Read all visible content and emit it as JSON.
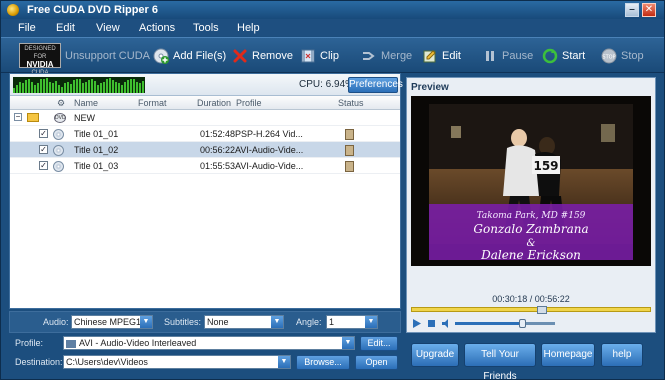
{
  "window": {
    "title": "Free CUDA DVD Ripper 6"
  },
  "menu": [
    "File",
    "Edit",
    "View",
    "Actions",
    "Tools",
    "Help"
  ],
  "toolbar": {
    "cuda_label": "Unsupport CUDA",
    "add_files": "Add File(s)",
    "remove": "Remove",
    "clip": "Clip",
    "merge": "Merge",
    "edit": "Edit",
    "pause": "Pause",
    "start": "Start",
    "stop": "Stop"
  },
  "nvidia_badge": {
    "top": "DESIGNED FOR",
    "brand": "NVIDIA",
    "bottom": "CUDA"
  },
  "status": {
    "cpu": "CPU: 6.94%",
    "preferences": "Preferences"
  },
  "meter_levels": [
    0.3,
    0.5,
    0.7,
    0.6,
    0.8,
    0.9,
    0.7,
    0.5,
    0.6,
    0.85,
    0.9,
    0.95,
    0.7,
    0.6,
    0.75,
    0.5,
    0.4,
    0.6,
    0.7,
    0.55,
    0.8,
    0.9,
    0.85,
    0.6,
    0.7,
    0.8,
    0.9,
    0.75,
    0.5,
    0.6,
    0.7,
    0.85,
    0.95,
    0.8,
    0.7,
    0.6,
    0.5,
    0.7,
    0.8,
    0.9,
    0.85,
    0.7,
    0.6,
    0.75
  ],
  "columns": {
    "name": "Name",
    "format": "Format",
    "duration": "Duration",
    "profile": "Profile",
    "status": "Status"
  },
  "root": {
    "label": "NEW",
    "dvd": "DVD"
  },
  "titles": [
    {
      "name": "Title 01_01",
      "duration": "01:52:48",
      "profile": "PSP-H.264 Vid...",
      "checked": true,
      "selected": false
    },
    {
      "name": "Title 01_02",
      "duration": "00:56:22",
      "profile": "AVI-Audio-Vide...",
      "checked": true,
      "selected": true
    },
    {
      "name": "Title 01_03",
      "duration": "01:55:53",
      "profile": "AVI-Audio-Vide...",
      "checked": true,
      "selected": false
    }
  ],
  "audio": {
    "audio_label": "Audio:",
    "audio_value": "Chinese MPEG1 :",
    "subtitles_label": "Subtitles:",
    "subtitles_value": "None",
    "angle_label": "Angle:",
    "angle_value": "1"
  },
  "profile": {
    "label": "Profile:",
    "value": "AVI - Audio-Video Interleaved",
    "edit": "Edit..."
  },
  "destination": {
    "label": "Destination:",
    "value": "C:\\Users\\dev\\Videos",
    "browse": "Browse...",
    "open": "Open"
  },
  "preview": {
    "title": "Preview",
    "caption_line1": "Takoma Park, MD #159",
    "caption_line2": "Gonzalo Zambrana",
    "caption_line3": "&",
    "caption_line4": "Dalene Erickson",
    "bib": "159",
    "timecode": "00:30:18 / 00:56:22",
    "progress": 0.54,
    "volume": 0.68
  },
  "bottom_buttons": {
    "upgrade": "Upgrade",
    "tell": "Tell Your Friends",
    "homepage": "Homepage",
    "help": "help"
  },
  "colors": {
    "accent": "#2b6fb8",
    "window": "#1c4e7e",
    "caption_band": "#7a1ea8"
  }
}
